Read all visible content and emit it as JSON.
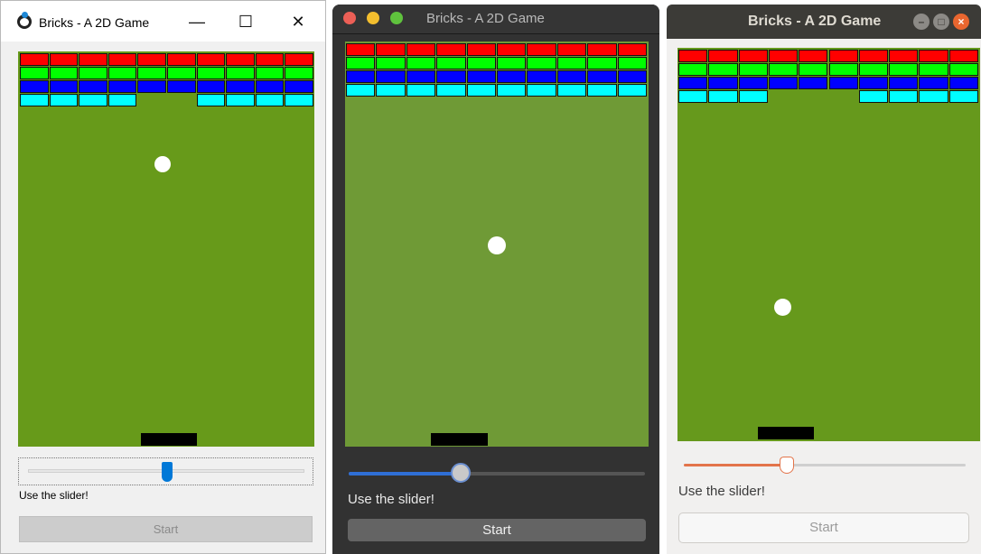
{
  "colors": {
    "brick_red": "#ff0000",
    "brick_green": "#00ff00",
    "brick_blue": "#0000ff",
    "brick_cyan": "#00ffff",
    "ball": "#ffffff",
    "paddle": "#000000"
  },
  "windows": [
    {
      "platform": "windows",
      "title": "Bricks - A 2D Game",
      "controls": {
        "minimize": "—",
        "maximize": "☐",
        "close": "✕"
      },
      "bricks": {
        "red": [
          1,
          1,
          1,
          1,
          1,
          1,
          1,
          1,
          1,
          1
        ],
        "green": [
          1,
          1,
          1,
          1,
          1,
          1,
          1,
          1,
          1,
          1
        ],
        "blue": [
          1,
          1,
          1,
          1,
          1,
          1,
          1,
          1,
          1,
          1
        ],
        "cyan": [
          1,
          1,
          1,
          1,
          0,
          0,
          1,
          1,
          1,
          1
        ]
      },
      "slider_value": 0.5,
      "slider_hint": "Use the slider!",
      "start_label": "Start",
      "start_enabled": false
    },
    {
      "platform": "macos",
      "title": "Bricks - A 2D Game",
      "bricks": {
        "red": [
          1,
          1,
          1,
          1,
          1,
          1,
          1,
          1,
          1,
          1
        ],
        "green": [
          1,
          1,
          1,
          1,
          1,
          1,
          1,
          1,
          1,
          1
        ],
        "blue": [
          1,
          1,
          1,
          1,
          1,
          1,
          1,
          1,
          1,
          1
        ],
        "cyan": [
          1,
          1,
          1,
          1,
          1,
          1,
          1,
          1,
          1,
          1
        ]
      },
      "slider_value": 0.38,
      "slider_hint": "Use the slider!",
      "start_label": "Start",
      "start_enabled": true
    },
    {
      "platform": "ubuntu",
      "title": "Bricks - A 2D Game",
      "controls": {
        "minimize": "–",
        "maximize": "□",
        "close": "×"
      },
      "bricks": {
        "red": [
          1,
          1,
          1,
          1,
          1,
          1,
          1,
          1,
          1,
          1
        ],
        "green": [
          1,
          1,
          1,
          1,
          1,
          1,
          1,
          1,
          1,
          1
        ],
        "blue": [
          1,
          1,
          1,
          1,
          1,
          1,
          1,
          1,
          1,
          1
        ],
        "cyan": [
          1,
          1,
          1,
          0,
          0,
          0,
          1,
          1,
          1,
          1
        ]
      },
      "slider_value": 0.37,
      "slider_hint": "Use the slider!",
      "start_label": "Start",
      "start_enabled": false
    }
  ]
}
